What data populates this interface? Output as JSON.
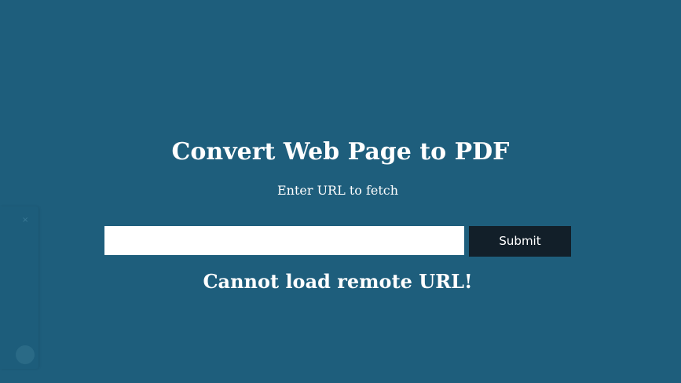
{
  "page": {
    "background_color": "#1e5e7c",
    "title": "Convert Web Page to PDF",
    "subtitle": "Enter URL to fetch",
    "error_message": "Cannot load remote URL!"
  },
  "form": {
    "url_value": "",
    "submit_label": "Submit",
    "submit_color": "#121f29"
  },
  "side_panel": {
    "close_icon": "close-icon",
    "close_glyph": "×"
  }
}
